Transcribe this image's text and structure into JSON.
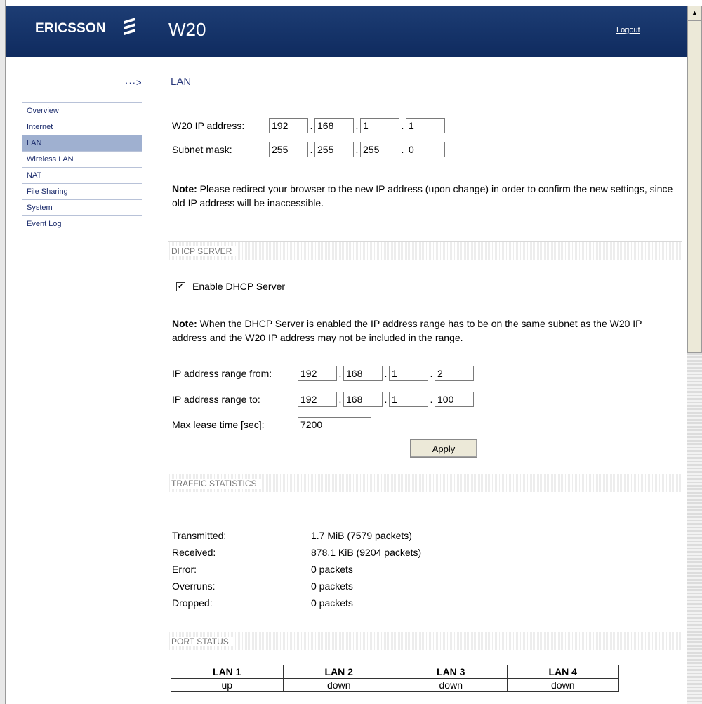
{
  "header": {
    "brand": "ERICSSON",
    "product": "W20",
    "logout": "Logout"
  },
  "sidebar": {
    "items": [
      {
        "label": "Overview"
      },
      {
        "label": "Internet"
      },
      {
        "label": "LAN",
        "active": true
      },
      {
        "label": "Wireless LAN"
      },
      {
        "label": "NAT"
      },
      {
        "label": "File Sharing"
      },
      {
        "label": "System"
      },
      {
        "label": "Event Log"
      }
    ]
  },
  "lan": {
    "title": "LAN",
    "ip_label": "W20 IP address:",
    "ip": [
      "192",
      "168",
      "1",
      "1"
    ],
    "mask_label": "Subnet mask:",
    "mask": [
      "255",
      "255",
      "255",
      "0"
    ],
    "note_bold": "Note:",
    "note_text": " Please redirect your browser to the new IP address (upon change) in order to confirm the new settings, since old IP address will be inaccessible."
  },
  "dhcp": {
    "heading": "DHCP SERVER",
    "checkbox_label": "Enable DHCP Server",
    "checked": true,
    "note_bold": "Note:",
    "note_text": " When the DHCP Server is enabled the IP address range has to be on the same subnet as the W20 IP address and the W20 IP address may not be included in the range.",
    "from_label": "IP address range from:",
    "from": [
      "192",
      "168",
      "1",
      "2"
    ],
    "to_label": "IP address range to:",
    "to": [
      "192",
      "168",
      "1",
      "100"
    ],
    "lease_label": "Max lease time [sec]:",
    "lease": "7200",
    "apply": "Apply"
  },
  "traffic": {
    "heading": "TRAFFIC STATISTICS",
    "rows": [
      {
        "label": "Transmitted:",
        "value": "1.7 MiB (7579 packets)"
      },
      {
        "label": "Received:",
        "value": "878.1 KiB (9204 packets)"
      },
      {
        "label": "Error:",
        "value": "0 packets"
      },
      {
        "label": "Overruns:",
        "value": "0 packets"
      },
      {
        "label": "Dropped:",
        "value": "0 packets"
      }
    ]
  },
  "ports": {
    "heading": "PORT STATUS",
    "headers": [
      "LAN 1",
      "LAN 2",
      "LAN 3",
      "LAN 4"
    ],
    "values": [
      "up",
      "down",
      "down",
      "down"
    ]
  },
  "colors": {
    "header_bg": "#14316a",
    "nav_active": "#9fb0d0",
    "title_blue": "#2c3b7c"
  }
}
